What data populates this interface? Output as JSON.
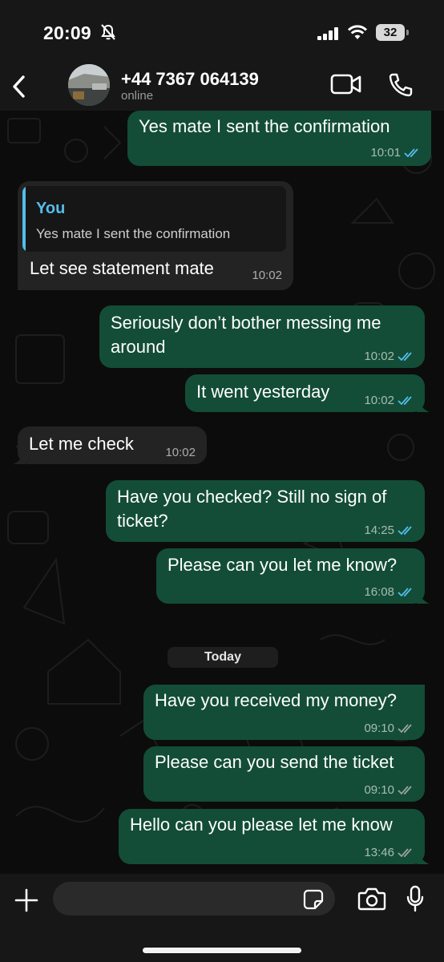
{
  "status": {
    "time": "20:09",
    "battery": "32"
  },
  "header": {
    "contact_name": "+44 7367 064139",
    "contact_status": "online"
  },
  "quote": {
    "author": "You",
    "text": "Yes mate I sent the confirmation"
  },
  "messages": [
    {
      "direction": "out",
      "text": "Yes mate I sent the confirmation",
      "time": "10:01",
      "read": true
    },
    {
      "direction": "in",
      "text": "Let see statement mate",
      "time": "10:02"
    },
    {
      "direction": "out",
      "text": "Seriously don’t bother messing me around",
      "time": "10:02",
      "read": true
    },
    {
      "direction": "out",
      "text": "It went yesterday",
      "time": "10:02",
      "read": true
    },
    {
      "direction": "in",
      "text": "Let me check",
      "time": "10:02"
    },
    {
      "direction": "out",
      "text": "Have you checked? Still no sign of ticket?",
      "time": "14:25",
      "read": true
    },
    {
      "direction": "out",
      "text": "Please can you let me know?",
      "time": "16:08",
      "read": true
    },
    {
      "direction": "out",
      "text": "Have you received my money?",
      "time": "09:10",
      "read": false
    },
    {
      "direction": "out",
      "text": "Please can you send the ticket",
      "time": "09:10",
      "read": false
    },
    {
      "direction": "out",
      "text": "Hello can you please let me know",
      "time": "13:46",
      "read": false
    }
  ],
  "day_separator": "Today",
  "composer": {
    "placeholder": ""
  },
  "colors": {
    "outgoing_bubble": "#134d37",
    "incoming_bubble": "#232323",
    "read_tick": "#53bdeb",
    "unread_tick": "#9aa39f",
    "quote_accent": "#53bdeb"
  },
  "icons": [
    "back-icon",
    "video-icon",
    "call-icon",
    "plus-icon",
    "sticker-icon",
    "camera-icon",
    "mic-icon",
    "bell-slash-icon",
    "signal-icon",
    "wifi-icon"
  ]
}
